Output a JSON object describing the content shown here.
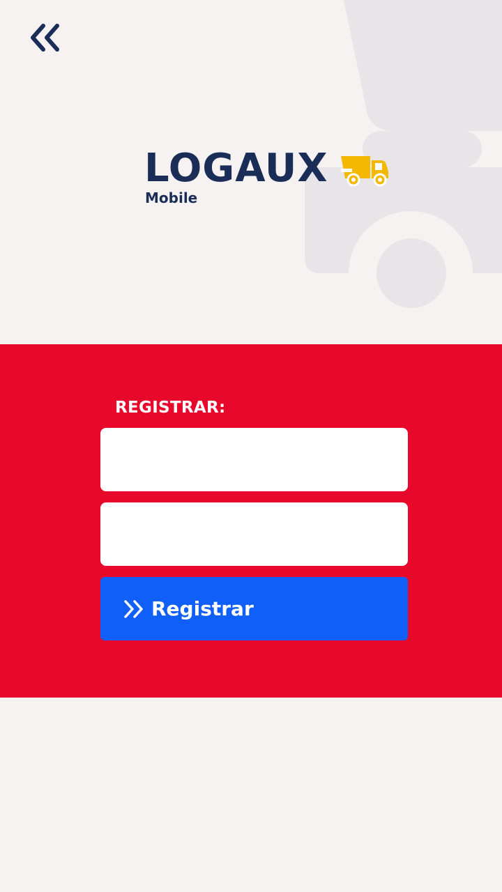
{
  "header": {
    "back_icon": "double-chevron-left-icon"
  },
  "logo": {
    "name": "LOGAUX",
    "subtitle": "Mobile",
    "icon": "delivery-truck-icon"
  },
  "register_form": {
    "title": "REGISTRAR:",
    "field_1": {
      "value": "",
      "placeholder": ""
    },
    "field_2": {
      "value": "",
      "placeholder": ""
    },
    "submit_label": "Registrar",
    "submit_icon": "double-chevron-right-icon"
  },
  "colors": {
    "background": "#f7f2f2",
    "panel_red": "#e8082b",
    "button_blue": "#115ff9",
    "navy": "#1a2d57",
    "truck_yellow": "#f5b800",
    "truck_silhouette": "#e8e5e8"
  }
}
